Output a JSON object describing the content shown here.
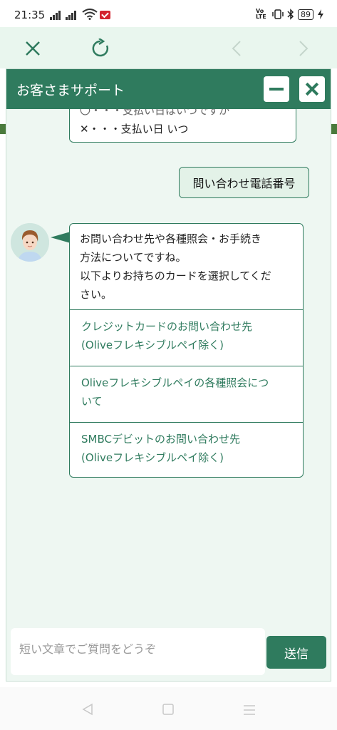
{
  "status_bar": {
    "time": "21:35",
    "battery": "89",
    "network_label": "Vo LTE"
  },
  "browser": {
    "close_icon": "close-icon",
    "reload_icon": "reload-icon",
    "back_icon": "chevron-left-icon",
    "forward_icon": "chevron-right-icon"
  },
  "chat": {
    "title": "お客さまサポート",
    "header_accent": "#2f7b5e",
    "previous_bubble": {
      "line1": "〇・・・支払い日はいつですか",
      "line2": "✕・・・支払い日 いつ"
    },
    "user_message": "問い合わせ電話番号",
    "bot_message": {
      "text_lines": [
        "お問い合わせ先や各種照会・お手続き",
        "方法についてですね。",
        "以下よりお持ちのカードを選択してくだ",
        "さい。"
      ],
      "options": [
        {
          "line1": "クレジットカードのお問い合わせ先",
          "line2": "(Oliveフレキシブルペイ除く)"
        },
        {
          "line1": "Oliveフレキシブルペイの各種照会につ",
          "line2": "いて"
        },
        {
          "line1": "SMBCデビットのお問い合わせ先",
          "line2": "(Oliveフレキシブルペイ除く)"
        }
      ]
    },
    "input_placeholder": "短い文章でご質問をどうぞ",
    "send_label": "送信"
  }
}
